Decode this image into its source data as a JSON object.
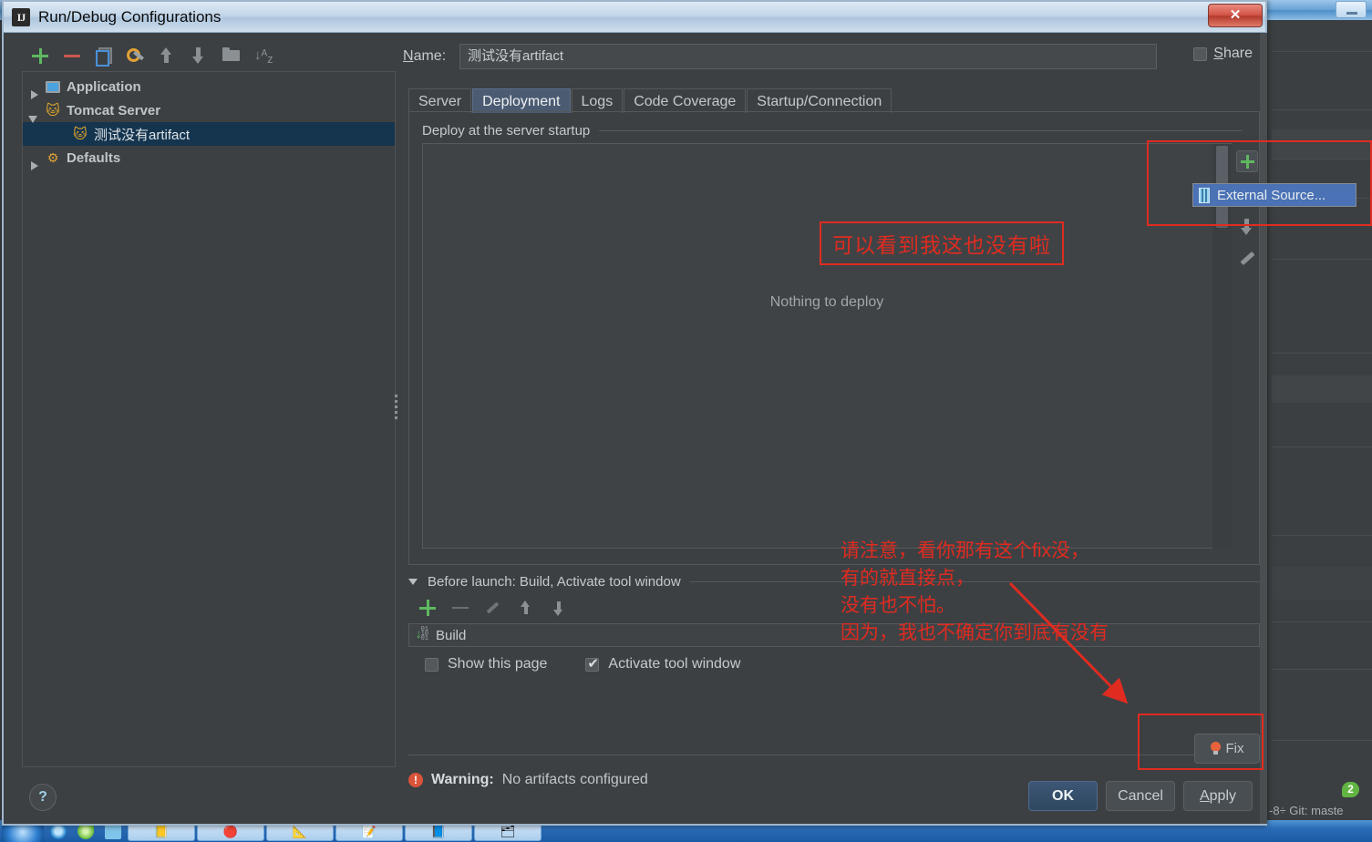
{
  "dialog": {
    "title": "Run/Debug Configurations",
    "icon": "intellij-idea-icon",
    "close_label": "✕"
  },
  "tree_toolbar": [
    {
      "name": "add-configuration-button",
      "icon": "plus-icon"
    },
    {
      "name": "remove-configuration-button",
      "icon": "minus-icon"
    },
    {
      "name": "copy-configuration-button",
      "icon": "copy-icon"
    },
    {
      "name": "edit-defaults-button",
      "icon": "wrench-icon"
    },
    {
      "name": "move-up-button",
      "icon": "arrow-up-icon"
    },
    {
      "name": "move-down-button",
      "icon": "arrow-down-icon"
    },
    {
      "name": "create-folder-button",
      "icon": "folder-icon"
    },
    {
      "name": "sort-configurations-button",
      "icon": "sort-az-icon",
      "glyph": "↓ᵃ𝘇"
    }
  ],
  "tree": {
    "items": [
      {
        "label": "Application",
        "icon": "application-icon",
        "expander": "collapsed",
        "level": 0,
        "selected": false
      },
      {
        "label": "Tomcat Server",
        "icon": "tomcat-icon",
        "expander": "expanded",
        "level": 0,
        "selected": false
      },
      {
        "label": "测试没有artifact",
        "icon": "tomcat-icon",
        "expander": "none",
        "level": 1,
        "selected": true
      },
      {
        "label": "Defaults",
        "icon": "gear-icon",
        "expander": "collapsed",
        "level": 0,
        "selected": false
      }
    ]
  },
  "name_field": {
    "label": "Name:",
    "label_mnemonic": "N",
    "value": "测试没有artifact",
    "placeholder": ""
  },
  "share": {
    "label": "Share",
    "label_mnemonic": "S",
    "checked": false
  },
  "tabs": [
    {
      "label": "Server",
      "active": false
    },
    {
      "label": "Deployment",
      "active": true
    },
    {
      "label": "Logs",
      "active": false
    },
    {
      "label": "Code Coverage",
      "active": false
    },
    {
      "label": "Startup/Connection",
      "active": false
    }
  ],
  "deployment": {
    "legend": "Deploy at the server startup",
    "empty_text": "Nothing to deploy",
    "sidebar": [
      {
        "name": "add-deployment-button",
        "icon": "plus-icon"
      },
      {
        "name": "move-up-deployment-button",
        "icon": "arrow-up-icon"
      },
      {
        "name": "move-down-deployment-button",
        "icon": "arrow-down-icon"
      },
      {
        "name": "edit-deployment-button",
        "icon": "pencil-icon"
      }
    ]
  },
  "external_source_menu": {
    "item_label": "External Source...",
    "icon": "artifact-icon",
    "highlight_color": "#4a72b5"
  },
  "before_launch": {
    "header": "Before launch: Build, Activate tool window",
    "header_mnemonic": "B",
    "toolbar": [
      {
        "name": "add-task-button",
        "icon": "plus-icon"
      },
      {
        "name": "remove-task-button",
        "icon": "minus-icon"
      },
      {
        "name": "edit-task-button",
        "icon": "pencil-icon"
      },
      {
        "name": "move-task-up-button",
        "icon": "arrow-up-icon"
      },
      {
        "name": "move-task-down-button",
        "icon": "arrow-down-icon"
      }
    ],
    "tasks": [
      {
        "label": "Build",
        "icon": "build-icon"
      }
    ],
    "checkboxes": [
      {
        "label": "Show this page",
        "checked": false
      },
      {
        "label": "Activate tool window",
        "checked": true
      }
    ]
  },
  "warning": {
    "icon": "error-icon",
    "prefix": "Warning:",
    "message": "No artifacts configured"
  },
  "fix_button": {
    "label": "Fix",
    "icon": "lightbulb-icon"
  },
  "footer": {
    "help_label": "?",
    "buttons": [
      {
        "label": "OK",
        "primary": true,
        "mnemonic": ""
      },
      {
        "label": "Cancel",
        "primary": false,
        "mnemonic": ""
      },
      {
        "label": "Apply",
        "primary": false,
        "mnemonic": "A"
      }
    ]
  },
  "annotations": {
    "color": "#e02b20",
    "note_1": "可以看到我这也没有啦",
    "note_2": "请注意，看你那有这个fix没，\n有的就直接点，\n没有也不怕。\n因为，我也不确定你到底有没有"
  },
  "background": {
    "status_text": "-8÷  Git: maste",
    "badge_count": "2"
  }
}
